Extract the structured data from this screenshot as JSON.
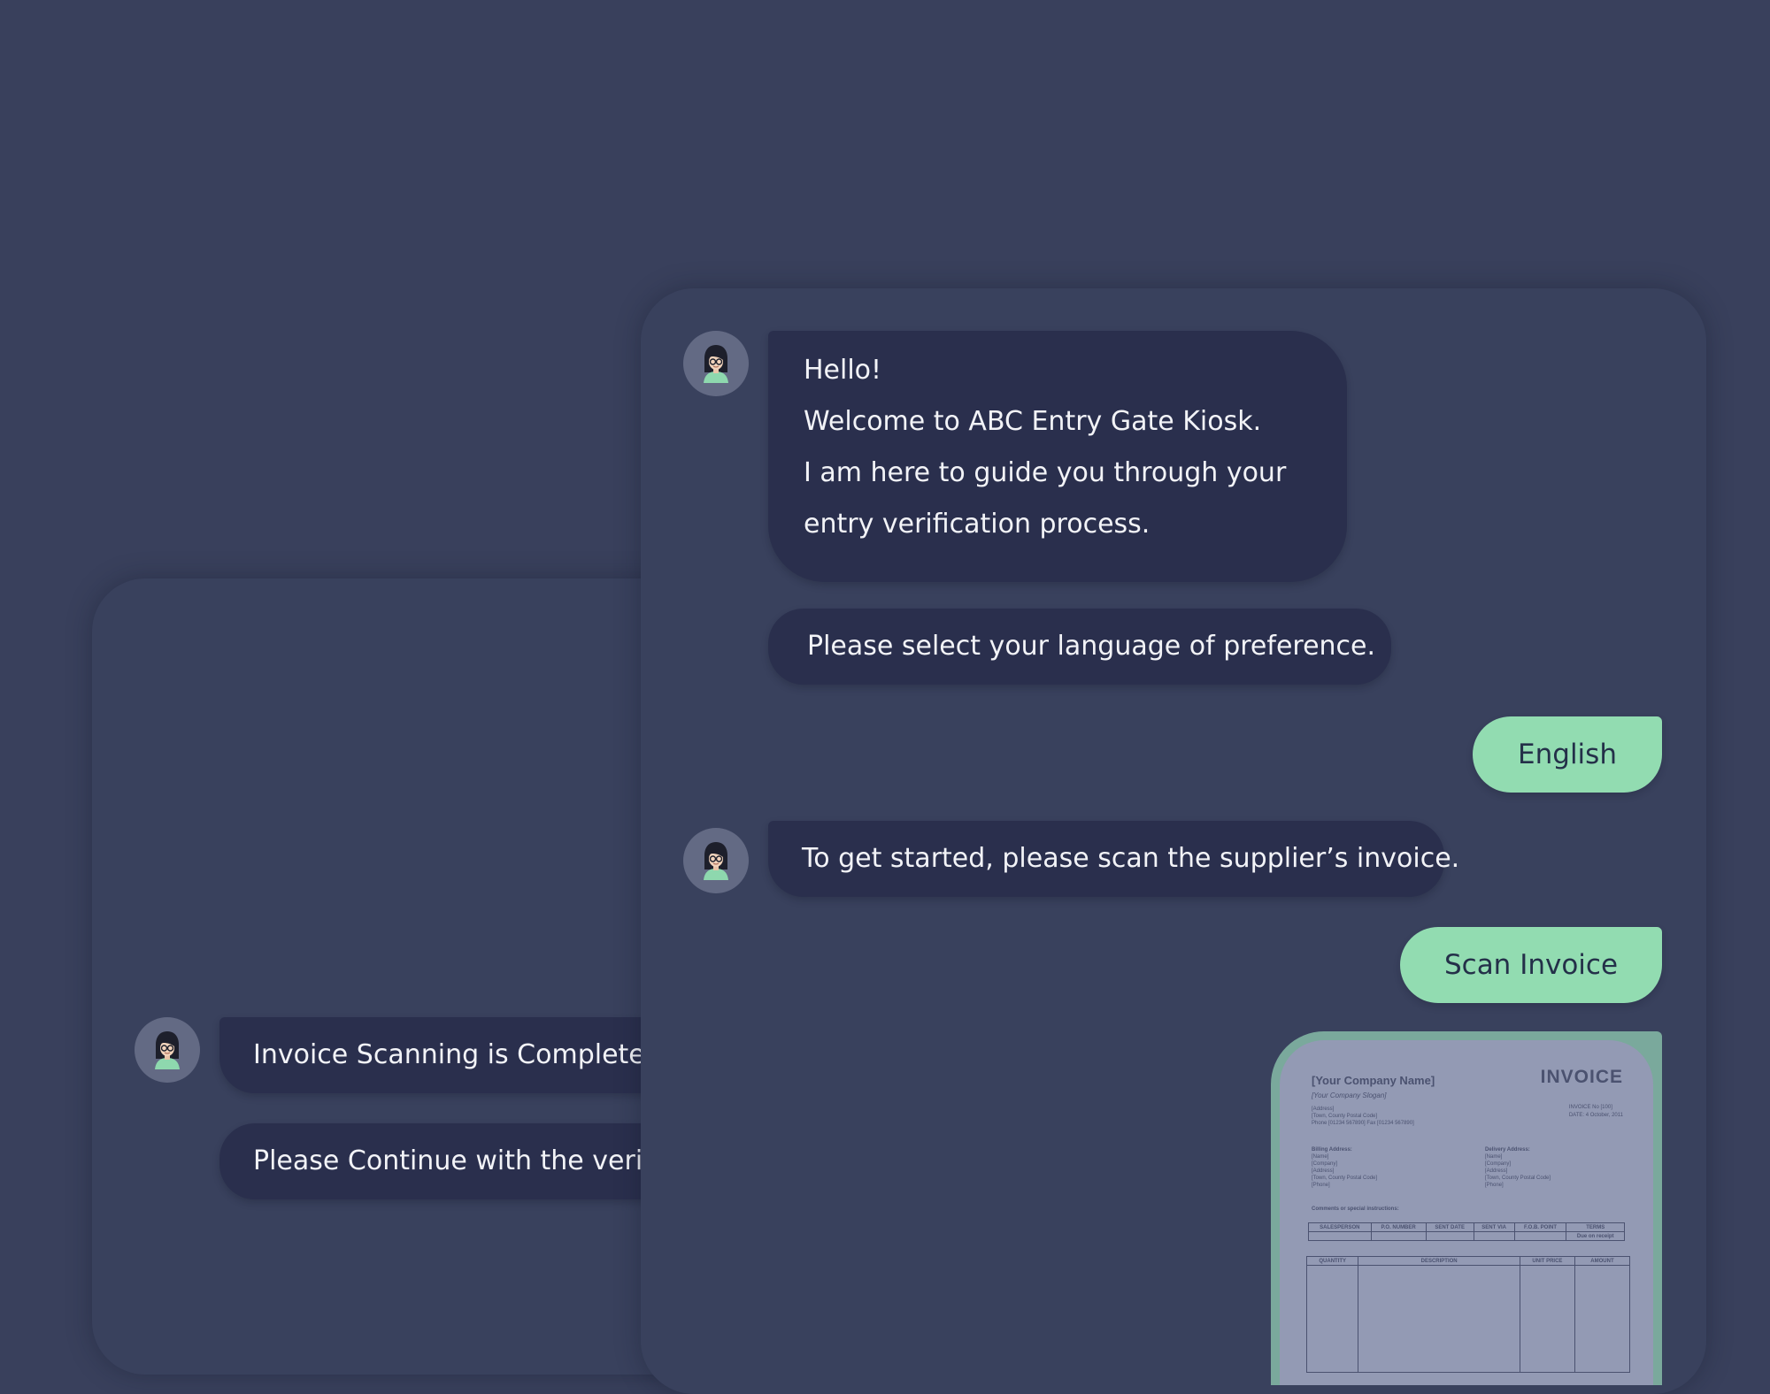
{
  "colors": {
    "background": "#39405c",
    "panel": "#39415d",
    "bot_bubble": "#2a2f4d",
    "bot_text": "#f2f3f7",
    "user_reply": "#92dcb1",
    "user_reply_text": "#243049",
    "avatar_ring": "#636a84"
  },
  "back_panel": {
    "messages": [
      "Invoice Scanning is Complete.",
      "Please Continue with the verifi"
    ]
  },
  "front_panel": {
    "greeting_lines": [
      "Hello!",
      "Welcome to ABC Entry Gate Kiosk.",
      "I am here to guide you through your",
      "entry verification process."
    ],
    "language_prompt": "Please select your language of preference.",
    "language_reply": "English",
    "scan_prompt": "To get started, please scan the supplier’s invoice.",
    "scan_reply": "Scan Invoice",
    "invoice_preview": {
      "company": "[Your Company Name]",
      "slogan": "[Your Company Slogan]",
      "title": "INVOICE",
      "meta": [
        "INVOICE No [100]",
        "DATE: 4 October, 2011"
      ],
      "address": [
        "[Address]",
        "[Town, County Postal Code]",
        "Phone [01234 567890] Fax [01234 567890]"
      ],
      "billing": [
        "Billing Address:",
        "[Name]",
        "[Company]",
        "[Address]",
        "[Town, County Postal Code]",
        "[Phone]"
      ],
      "delivery": [
        "Delivery Address:",
        "[Name]",
        "[Company]",
        "[Address]",
        "[Town, County Postal Code]",
        "[Phone]"
      ],
      "comments": "Comments or special instructions:",
      "top_columns": [
        "SALESPERSON",
        "P.O. NUMBER",
        "SENT DATE",
        "SENT VIA",
        "F.O.B. POINT",
        "TERMS"
      ],
      "top_cell": "Due on receipt",
      "bottom_columns": [
        "QUANTITY",
        "DESCRIPTION",
        "UNIT PRICE",
        "AMOUNT"
      ]
    }
  }
}
